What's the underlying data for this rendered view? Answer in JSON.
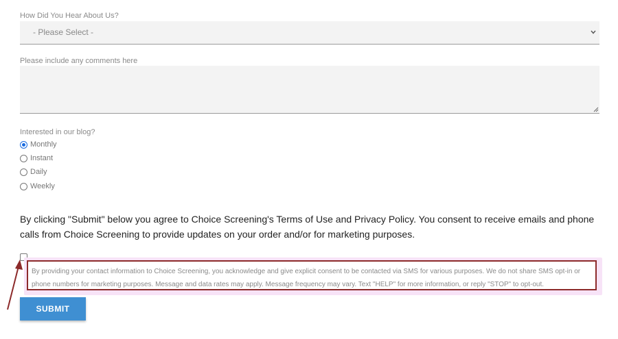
{
  "form": {
    "hear_label": "How Did You Hear About Us?",
    "hear_select_value": "- Please Select -",
    "comments_placeholder": "Please include any comments here",
    "blog_label": "Interested in our blog?",
    "blog_options": [
      {
        "label": "Monthly",
        "checked": true
      },
      {
        "label": "Instant",
        "checked": false
      },
      {
        "label": "Daily",
        "checked": false
      },
      {
        "label": "Weekly",
        "checked": false
      }
    ],
    "consent_text": "By clicking \"Submit\" below you agree to Choice Screening's Terms of Use and Privacy Policy. You consent to receive emails and phone calls from Choice Screening to provide updates on your order and/or for marketing purposes.",
    "sms_text": "By providing your contact information to Choice Screening, you acknowledge and give explicit consent to be contacted via SMS for various purposes. We do not share SMS opt-in or phone numbers for marketing purposes. Message and data rates may apply. Message frequency may vary. Text \"HELP\" for more information, or reply \"STOP\" to opt-out.",
    "submit_label": "SUBMIT"
  },
  "colors": {
    "accent": "#3f8fd2",
    "annotation": "#8c2a2a",
    "highlight": "#f7e3f7"
  }
}
